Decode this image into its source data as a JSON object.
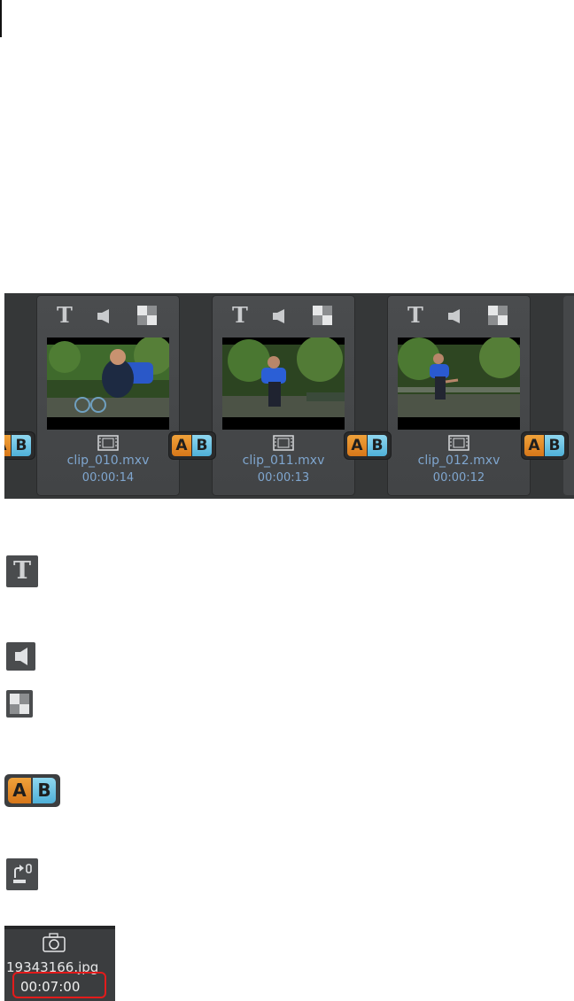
{
  "storyboard": {
    "clips": [
      {
        "name": "clip_010.mxv",
        "duration": "00:00:14"
      },
      {
        "name": "clip_011.mxv",
        "duration": "00:00:13"
      },
      {
        "name": "clip_012.mxv",
        "duration": "00:00:12"
      }
    ],
    "title_icon_glyph": "T",
    "transition_button": {
      "a": "A",
      "b": "B"
    },
    "icons": [
      "title-icon",
      "audio-icon",
      "transition-effect-icon",
      "film-strip-icon",
      "ab-transition-icon"
    ]
  },
  "legend": {
    "title_glyph": "T",
    "ab": {
      "a": "A",
      "b": "B"
    },
    "icons": [
      "title-icon",
      "audio-icon",
      "transition-effect-icon",
      "ab-transition-icon",
      "link-object-icon"
    ]
  },
  "image_clip": {
    "name": "19343166.jpg",
    "duration": "00:07:00",
    "icon": "camera-icon",
    "highlight_color": "#e31b1b"
  },
  "colors": {
    "strip_bg": "#353738",
    "clip_bg": "#454749",
    "text_blue": "#7fa6cf",
    "a_orange": "#e88d2a",
    "b_cyan": "#6cc4e4"
  }
}
